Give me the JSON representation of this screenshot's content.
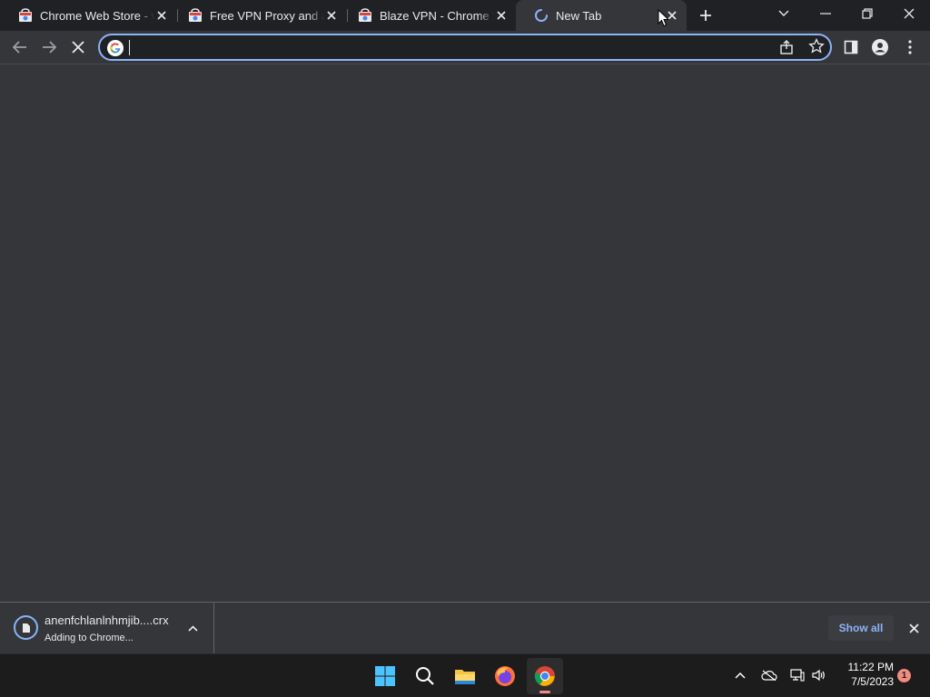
{
  "tabs": [
    {
      "title": "Chrome Web Store - vpn",
      "favicon": "chrome-web-store-icon",
      "close_icon": "close-icon"
    },
    {
      "title": "Free VPN Proxy and ad blocker",
      "favicon": "chrome-web-store-icon",
      "close_icon": "close-icon"
    },
    {
      "title": "Blaze VPN - Chrome Web Store",
      "favicon": "chrome-web-store-icon",
      "close_icon": "close-icon"
    },
    {
      "title": "New Tab",
      "favicon": "loading-spinner-icon",
      "close_icon": "close-icon",
      "active": true
    }
  ],
  "window_controls": {
    "tab_search": "chevron-down-icon",
    "minimize": "minimize-icon",
    "restore": "restore-icon",
    "close": "close-icon"
  },
  "toolbar": {
    "back": "arrow-left-icon",
    "forward": "arrow-right-icon",
    "stop": "stop-icon"
  },
  "omnibox": {
    "value": "",
    "placeholder": "",
    "search_engine_icon": "google-icon",
    "share_icon": "share-icon",
    "bookmark_icon": "star-icon"
  },
  "toolbar_right": {
    "side_panel": "side-panel-icon",
    "profile": "profile-icon",
    "menu": "more-vert-icon"
  },
  "download": {
    "filename": "anenfchlanlnhmjib....crx",
    "status": "Adding to Chrome...",
    "icon": "file-icon",
    "chevron": "chevron-up-icon"
  },
  "shelf": {
    "show_all": "Show all",
    "close_icon": "close-icon"
  },
  "taskbar": {
    "apps": [
      "windows-start-icon",
      "search-icon",
      "file-explorer-icon",
      "firefox-icon",
      "chrome-icon"
    ],
    "tray": [
      "chevron-up-icon",
      "cloud-offline-icon",
      "network-icon",
      "volume-icon"
    ],
    "time": "11:22 PM",
    "date": "7/5/2023",
    "notification_count": "1"
  },
  "colors": {
    "accent": "#8ab4f8",
    "frame": "#202124",
    "toolbar": "#35363a",
    "badge": "#f28b82"
  }
}
